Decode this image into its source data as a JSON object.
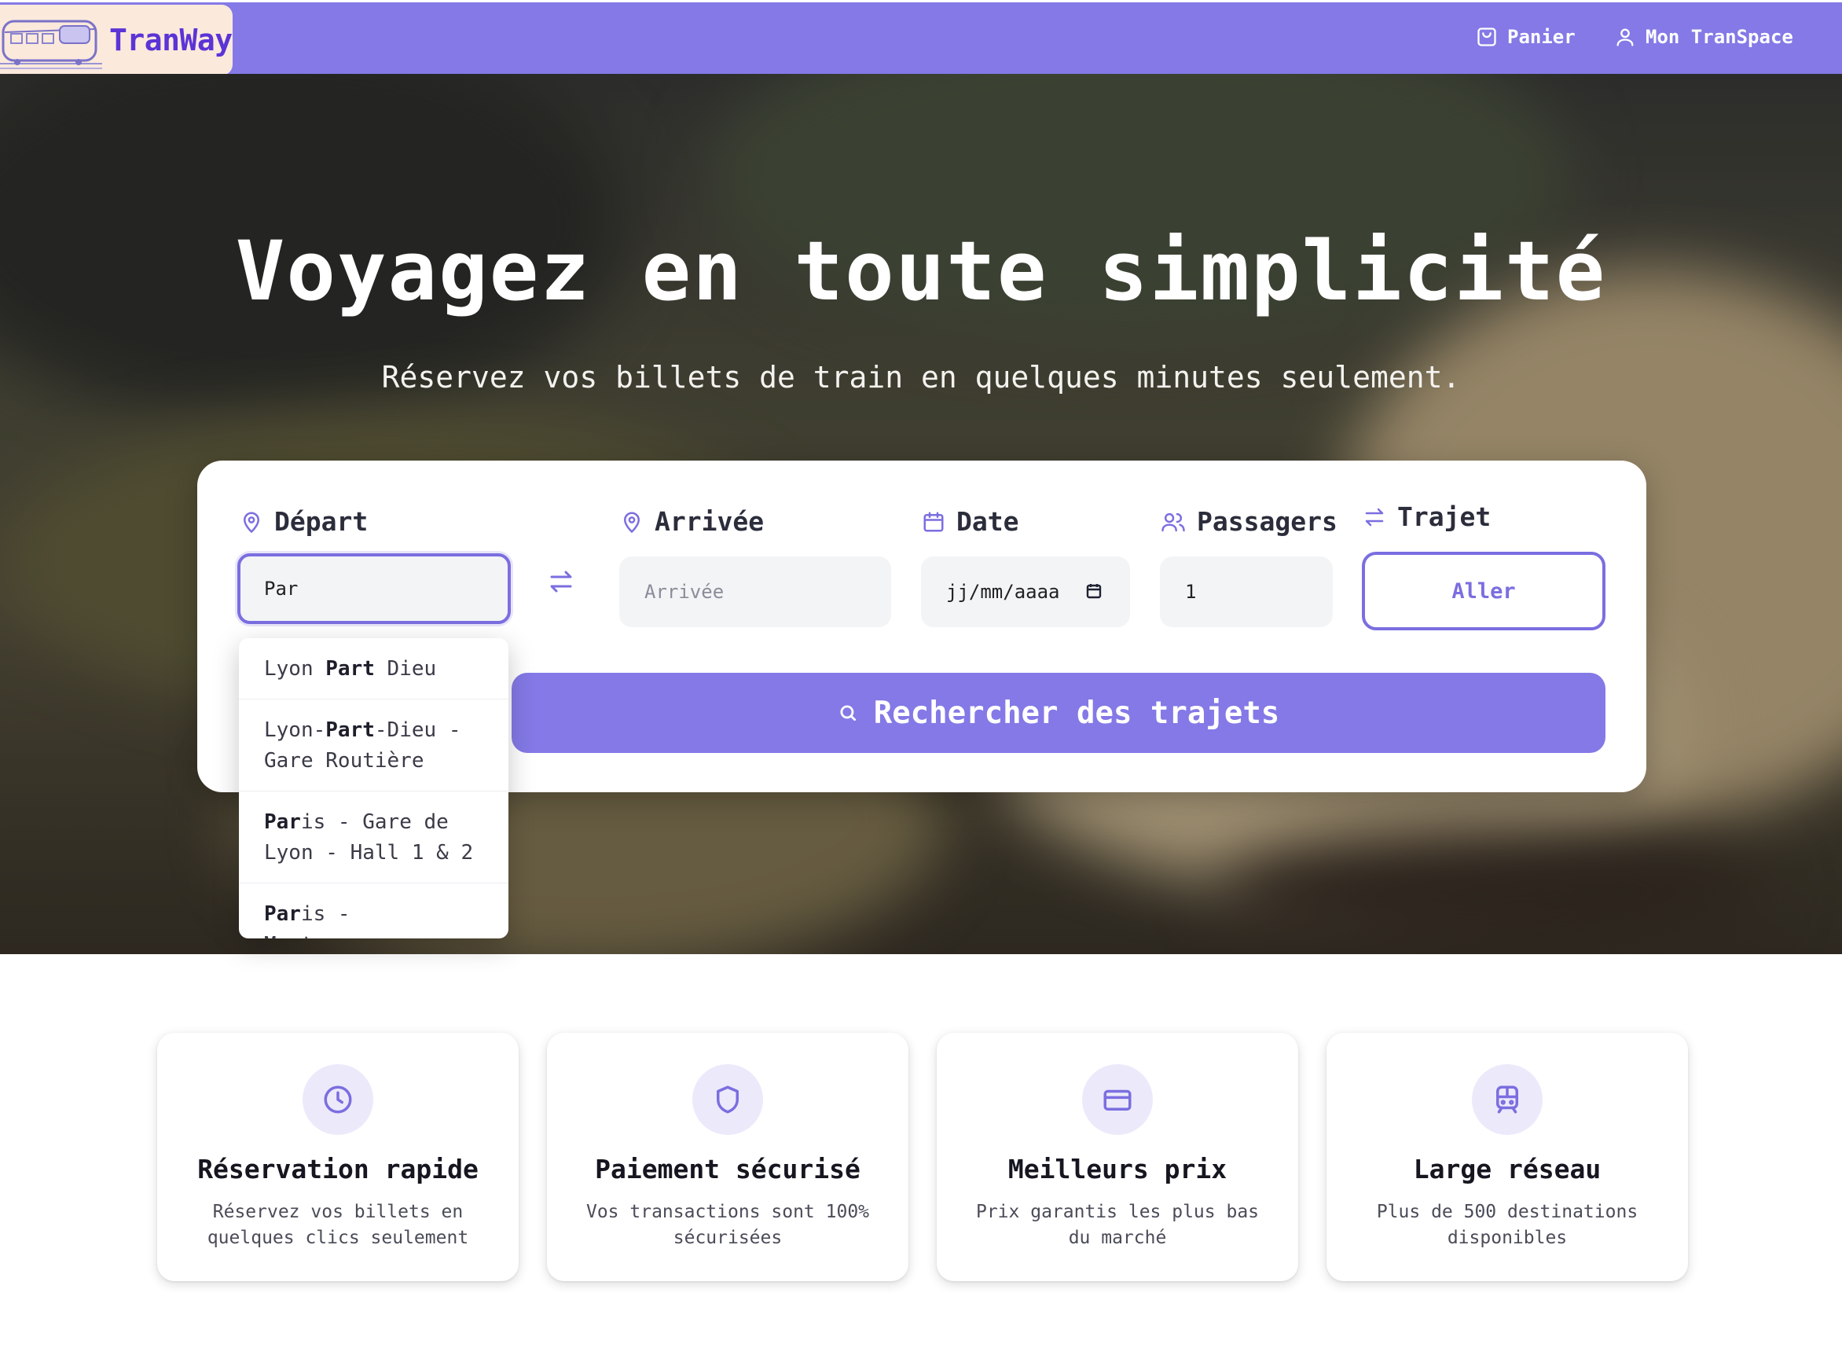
{
  "header": {
    "brand": "TranWay",
    "cart_label": "Panier",
    "account_label": "Mon TranSpace"
  },
  "hero": {
    "title": "Voyagez en toute simplicité",
    "subtitle": "Réservez vos billets de train en quelques minutes seulement."
  },
  "search": {
    "departure_label": "Départ",
    "departure_value": "Par",
    "arrival_label": "Arrivée",
    "arrival_placeholder": "Arrivée",
    "date_label": "Date",
    "date_value": "jj/mm/aaaa",
    "passengers_label": "Passagers",
    "passengers_value": "1",
    "trip_label": "Trajet",
    "trip_button": "Aller",
    "search_button": "Rechercher des trajets"
  },
  "suggestions": [
    {
      "pre": "Lyon ",
      "match": "Part",
      "post": " Dieu"
    },
    {
      "pre": "Lyon-",
      "match": "Part",
      "post": "-Dieu - Gare Routière"
    },
    {
      "pre": "",
      "match": "Par",
      "post": "is - Gare de Lyon - Hall 1 & 2"
    },
    {
      "pre": "",
      "match": "Par",
      "post": "is - Montparnasse"
    }
  ],
  "features": [
    {
      "icon": "clock-icon",
      "title": "Réservation rapide",
      "desc": "Réservez vos billets en quelques clics seulement"
    },
    {
      "icon": "shield-icon",
      "title": "Paiement sécurisé",
      "desc": "Vos transactions sont 100% sécurisées"
    },
    {
      "icon": "credit-card-icon",
      "title": "Meilleurs prix",
      "desc": "Prix garantis les plus bas du marché"
    },
    {
      "icon": "train-icon",
      "title": "Large réseau",
      "desc": "Plus de 500 destinations disponibles"
    }
  ],
  "colors": {
    "accent": "#8479e6",
    "accent_dark": "#7b6ee0",
    "brand_bg": "#fbe9dc",
    "brand_text": "#5b34d6",
    "icon_bg": "#ece9fb"
  }
}
